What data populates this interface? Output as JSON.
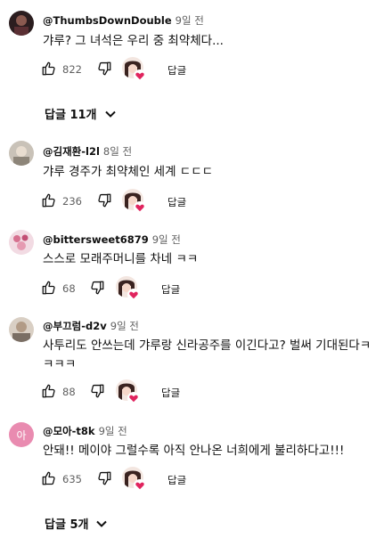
{
  "comments": [
    {
      "author": "@ThumbsDownDouble",
      "time": "9일 전",
      "text": "갸루? 그 녀석은 우리 중 최약체다...",
      "likes": "822",
      "reply_label": "답글"
    },
    {
      "author": "@김재환-l2l",
      "time": "8일 전",
      "text": "갸루 경주가 최약체인 세계 ㄷㄷㄷ",
      "likes": "236",
      "reply_label": "답글"
    },
    {
      "author": "@bittersweet6879",
      "time": "9일 전",
      "text": "스스로 모래주머니를 차네 ㅋㅋ",
      "likes": "68",
      "reply_label": "답글"
    },
    {
      "author": "@부끄럼-d2v",
      "time": "9일 전",
      "text": "사투리도 안쓰는데 갸루랑 신라공주를 이긴다고? 벌써 기대된다ㅋㅋㅋㅋ",
      "likes": "88",
      "reply_label": "답글"
    },
    {
      "author": "@모아-t8k",
      "time": "9일 전",
      "text": "안돼!! 메이야 그럴수록 아직 안나온 너희에게 불리하다고!!!",
      "likes": "635",
      "reply_label": "답글",
      "avatar_letter": "아"
    }
  ],
  "replies_toggles": [
    "답글 11개",
    "답글 5개"
  ],
  "colors": {
    "heart": "#e0245e",
    "avatar_pink": "#e98bb0",
    "meta_gray": "#606060"
  }
}
